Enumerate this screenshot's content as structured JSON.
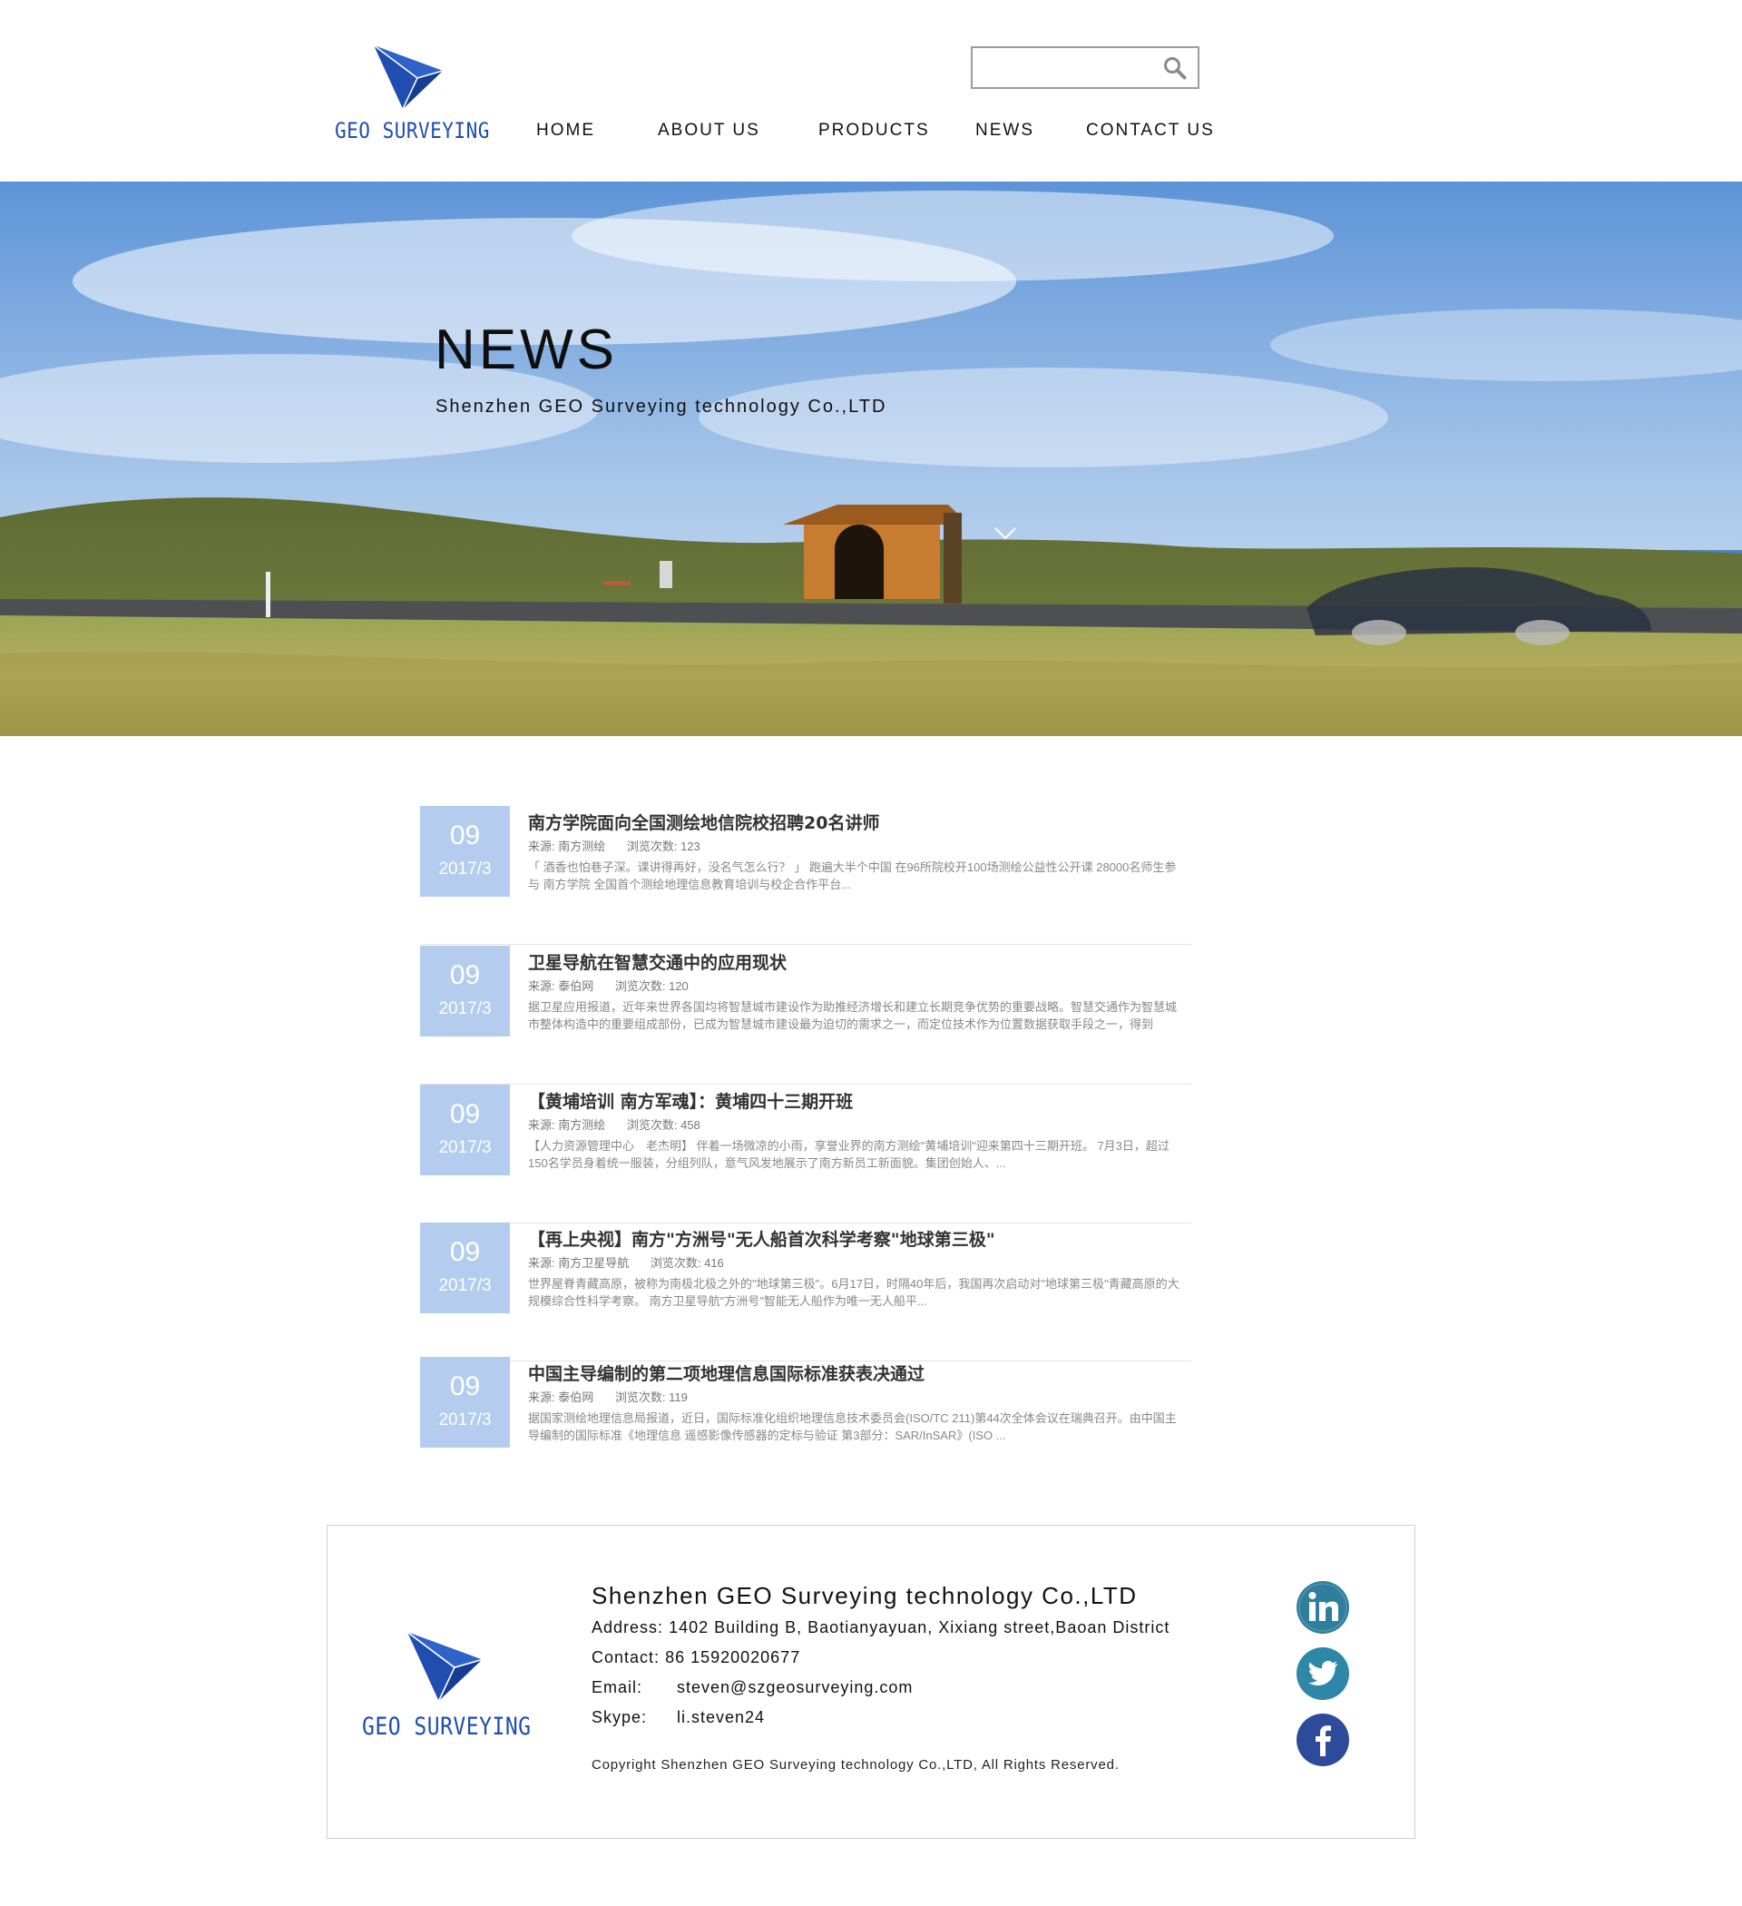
{
  "brand": {
    "name": "GEO SURVEYING",
    "color": "#1f4db0"
  },
  "search": {
    "placeholder": "",
    "icon": "search-icon"
  },
  "nav": {
    "items": [
      {
        "label": "HOME"
      },
      {
        "label": "ABOUT US"
      },
      {
        "label": "PRODUCTS"
      },
      {
        "label": "NEWS"
      },
      {
        "label": "CONTACT US"
      }
    ]
  },
  "hero": {
    "title": "NEWS",
    "subtitle": "Shenzhen GEO Surveying technology Co.,LTD",
    "scroll_icon": "chevron-down-icon"
  },
  "news": {
    "date_color": "#b4cdee",
    "items": [
      {
        "day": "09",
        "year_month": "2017/3",
        "title": "南方学院面向全国测绘地信院校招聘20名讲师",
        "source": "来源: 南方测绘",
        "views": "浏览次数: 123",
        "excerpt": "「 酒香也怕巷子深。课讲得再好，没名气怎么行？ 」 跑遍大半个中国 在96所院校开100场测绘公益性公开课 28000名师生参与 南方学院 全国首个测绘地理信息教育培训与校企合作平台..."
      },
      {
        "day": "09",
        "year_month": "2017/3",
        "title": "卫星导航在智慧交通中的应用现状",
        "source": "来源: 泰伯网",
        "views": "浏览次数: 120",
        "excerpt": "据卫星应用报道，近年来世界各国均将智慧城市建设作为助推经济增长和建立长期竞争优势的重要战略。智慧交通作为智慧城市整体构造中的重要组成部份，已成为智慧城市建设最为迫切的需求之一，而定位技术作为位置数据获取手段之一，得到"
      },
      {
        "day": "09",
        "year_month": "2017/3",
        "title": "【黄埔培训 南方军魂】：黄埔四十三期开班",
        "source": "来源: 南方测绘",
        "views": "浏览次数: 458",
        "excerpt": "【人力资源管理中心　老杰明】 伴着一场微凉的小雨，享誉业界的南方测绘\"黄埔培训\"迎来第四十三期开班。 7月3日，超过150名学员身着统一服装，分组列队，意气风发地展示了南方新员工新面貌。集团创始人、..."
      },
      {
        "day": "09",
        "year_month": "2017/3",
        "title": "【再上央视】南方\"方洲号\"无人船首次科学考察\"地球第三极\"",
        "source": "来源: 南方卫星导航",
        "views": "浏览次数: 416",
        "excerpt": "世界屋脊青藏高原，被称为南极北极之外的\"地球第三极\"。6月17日，时隔40年后，我国再次启动对\"地球第三极\"青藏高原的大规模综合性科学考察。 南方卫星导航\"方洲号\"智能无人船作为唯一无人船平..."
      },
      {
        "day": "09",
        "year_month": "2017/3",
        "title": "中国主导编制的第二项地理信息国际标准获表决通过",
        "source": "来源: 泰伯网",
        "views": "浏览次数: 119",
        "excerpt": "据国家测绘地理信息局报道，近日，国际标准化组织地理信息技术委员会(ISO/TC 211)第44次全体会议在瑞典召开。由中国主导编制的国际标准《地理信息 遥感影像传感器的定标与验证 第3部分：SAR/InSAR》(ISO ..."
      }
    ]
  },
  "footer": {
    "company": "Shenzhen GEO Surveying technology Co.,LTD",
    "address_label": "Address:",
    "address": "1402 Building B, Baotianyayuan, Xixiang street,Baoan District",
    "contact_label": "Contact:",
    "contact": "86 15920020677",
    "email_label": "Email:",
    "email": "steven@szgeosurveying.com",
    "skype_label": "Skype:",
    "skype": "li.steven24",
    "copyright": "Copyright Shenzhen GEO Surveying technology Co.,LTD, All Rights Reserved.",
    "social": [
      {
        "icon": "linkedin-icon",
        "color": "#2f7e9e"
      },
      {
        "icon": "twitter-icon",
        "color": "#2e86a8"
      },
      {
        "icon": "facebook-icon",
        "color": "#2d4b9a"
      }
    ]
  }
}
